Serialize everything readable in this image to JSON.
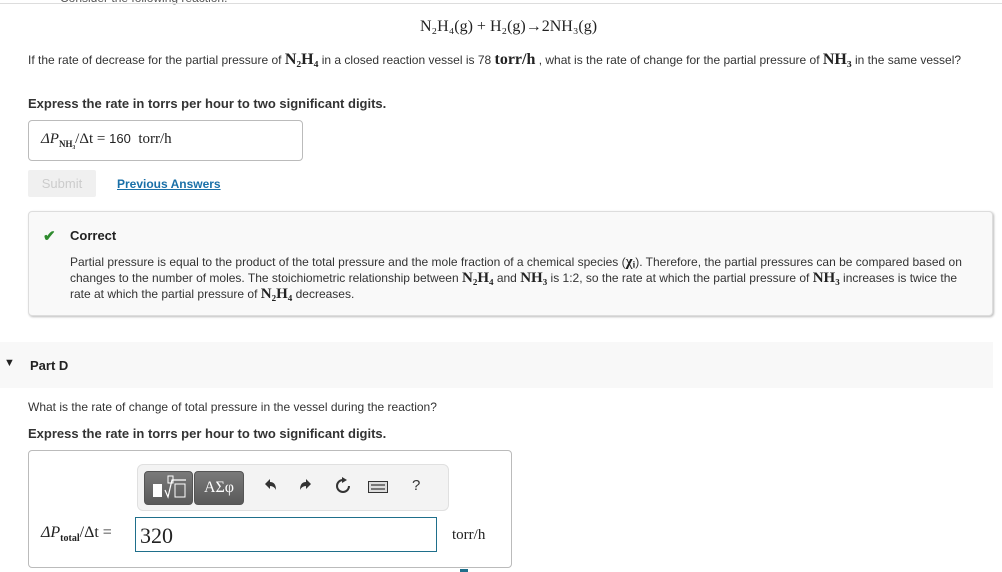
{
  "intro_text": "Consider the following reaction:",
  "reaction_equation": "N₂H₄(g) + H₂(g)→2NH₃(g)",
  "part_c": {
    "question": {
      "part1": "If the rate of decrease for the partial pressure of ",
      "species1": "N₂H₄",
      "part2": " in a closed reaction vessel is 78 ",
      "unit": "torr/h",
      "part3": " , what is the rate of change for the partial pressure of ",
      "species2": "NH₃",
      "part4": " in the same vessel?"
    },
    "instruction": "Express the rate in torrs per hour to two significant digits.",
    "answer_label": "ΔP",
    "answer_label_sub": "NH₃",
    "answer_label_tail": "/Δt = ",
    "answer_value": "160",
    "answer_unit": "torr/h",
    "submit_label": "Submit",
    "previous_answers_label": "Previous Answers",
    "feedback": {
      "status": "Correct",
      "status_color": "#2e8b2e",
      "text": {
        "s1": "Partial pressure is equal to the product of the total pressure and the mole fraction of a chemical species (",
        "chi": "χᵢ",
        "s2": "). Therefore, the partial pressures can be compared based on changes to the number of moles. The stoichiometric relationship between ",
        "sp1": "N₂H₄",
        "s3": " and ",
        "sp2": "NH₃",
        "s4": " is 1:2, so the rate at which the partial pressure of ",
        "sp3": "NH₃",
        "s5": " increases is twice the rate at which the partial pressure of ",
        "sp4": "N₂H₄",
        "s6": " decreases."
      }
    }
  },
  "part_d": {
    "title": "Part D",
    "question": "What is the rate of change of total pressure in the vessel during the reaction?",
    "instruction": "Express the rate in torrs per hour to two significant digits.",
    "toolbar": {
      "templates_icon": "templates-icon",
      "greek_label": "ΑΣφ",
      "undo_icon": "undo-icon",
      "redo_icon": "redo-icon",
      "reset_icon": "reset-icon",
      "keyboard_icon": "keyboard-icon",
      "help_label": "?"
    },
    "answer_label": "ΔP",
    "answer_label_sub": "total",
    "answer_label_tail": "/Δt = ",
    "answer_value": "320",
    "answer_unit": "torr/h"
  }
}
